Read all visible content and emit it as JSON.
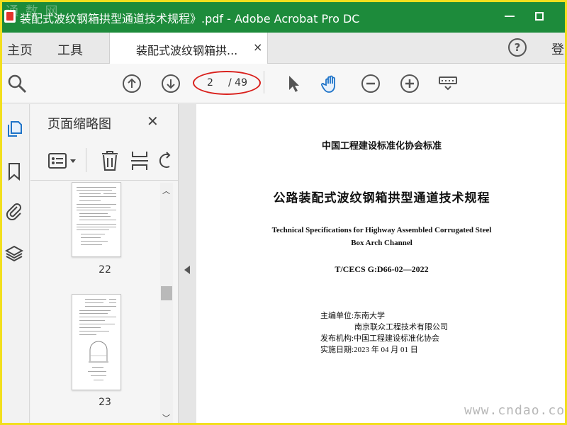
{
  "window": {
    "title": "装配式波纹钢箱拱型通道技术规程》.pdf - Adobe Acrobat Pro DC",
    "watermark": "通 数 网"
  },
  "tabs": {
    "home": "主页",
    "tools": "工具",
    "document": "装配式波纹钢箱拱...",
    "close": "×",
    "login": "登"
  },
  "toolbar": {
    "current_page": "2",
    "total_pages": "/ 49"
  },
  "thumbnail_panel": {
    "title": "页面缩略图",
    "close": "✕",
    "pages": [
      {
        "number": "22"
      },
      {
        "number": "23"
      }
    ]
  },
  "document": {
    "association": "中国工程建设标准化协会标准",
    "title_cn": "公路装配式波纹钢箱拱型通道技术规程",
    "title_en_line1": "Technical Specifications for Highway Assembled Corrugated Steel",
    "title_en_line2": "Box Arch Channel",
    "code": "T/CECS G:D66-02—2022",
    "editor_line1": "主编单位:东南大学",
    "editor_line2": "南京联众工程技术有限公司",
    "publisher": "发布机构:中国工程建设标准化协会",
    "effective_date": "实施日期:2023 年 04 月 01 日"
  },
  "site_watermark": "www.cndao.com",
  "colors": {
    "titlebar": "#1d8b3b",
    "frame": "#f2df1e",
    "highlight": "#d9201c",
    "hand_tool": "#1e73c8"
  }
}
